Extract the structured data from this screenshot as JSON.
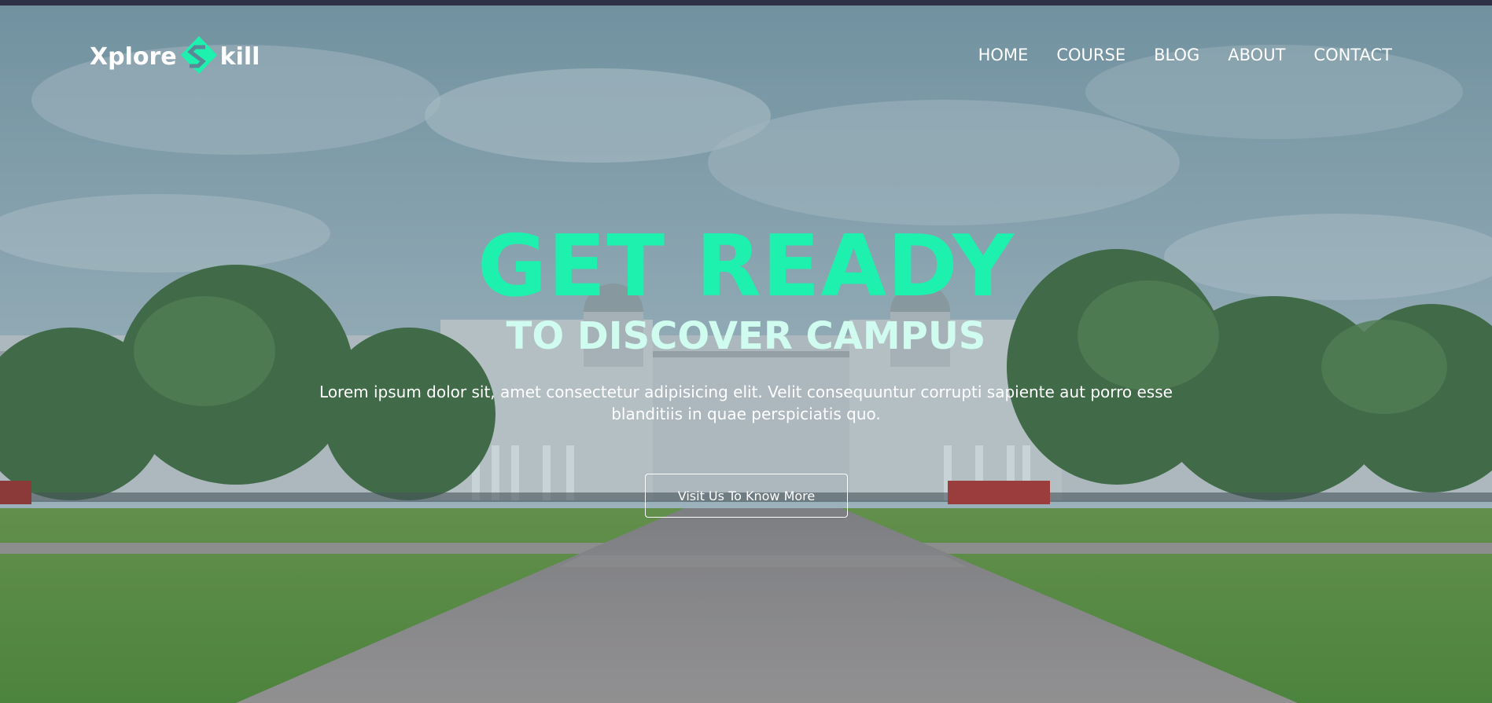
{
  "brand": {
    "name_prefix": "Xplore",
    "name_suffix": "kill",
    "accent_color": "#1ef0ae"
  },
  "nav": {
    "items": [
      {
        "label": "HOME"
      },
      {
        "label": "COURSE"
      },
      {
        "label": "BLOG"
      },
      {
        "label": "ABOUT"
      },
      {
        "label": "CONTACT"
      }
    ]
  },
  "hero": {
    "title": "GET READY",
    "subtitle": "TO DISCOVER CAMPUS",
    "description": "Lorem ipsum dolor sit, amet consectetur adipisicing elit. Velit consequuntur corrupti sapiente aut porro esse blanditiis in quae perspiciatis quo.",
    "cta_label": "Visit Us To Know More",
    "background_image": "campus-photo"
  }
}
